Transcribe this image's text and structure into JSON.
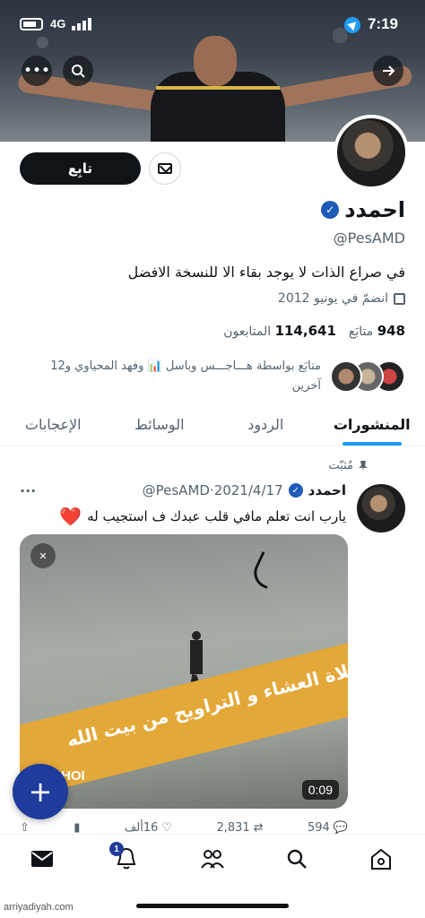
{
  "status_bar": {
    "time": "7:19",
    "network": "4G"
  },
  "profile": {
    "follow_label": "تابِع",
    "name": "احمدد",
    "handle": "@PesAMD",
    "bio": "في صراع الذات لا يوجد بقاء الا للنسخة الافضل",
    "joined": "انضمّ في يونيو 2012",
    "following_count": "948",
    "following_label": "متابَع",
    "followers_count": "114,641",
    "followers_label": "المتابعون",
    "followed_by": "متابَع بواسطة هـــاجـــس وباسل 📊 وفهد المحياوي و12 آخرين"
  },
  "tabs": [
    {
      "label": "المنشورات",
      "active": true
    },
    {
      "label": "الردود",
      "active": false
    },
    {
      "label": "الوسائط",
      "active": false
    },
    {
      "label": "الإعجابات",
      "active": false
    }
  ],
  "post": {
    "pinned_label": "مُثبّت",
    "author": "احمدد",
    "meta": "@PesAMD·2021/4/17",
    "more": "···",
    "text": "يارب انت تعلم مافي قلب عبدك ف استجيب له",
    "emoji": "❤️",
    "media": {
      "duration": "0:09",
      "overlay_text": "صلاة العشاء و التراويح من بيت الله",
      "watermark": "HOI"
    },
    "actions": {
      "replies": "594",
      "reposts": "2,831",
      "likes": "16ألف"
    }
  },
  "nav": {
    "notifications_badge": "1"
  },
  "watermark": "arriyadiyah.com",
  "colors": {
    "accent": "#1d9bf0",
    "verified": "#1d5bb8",
    "fab": "#1f3c9c"
  }
}
